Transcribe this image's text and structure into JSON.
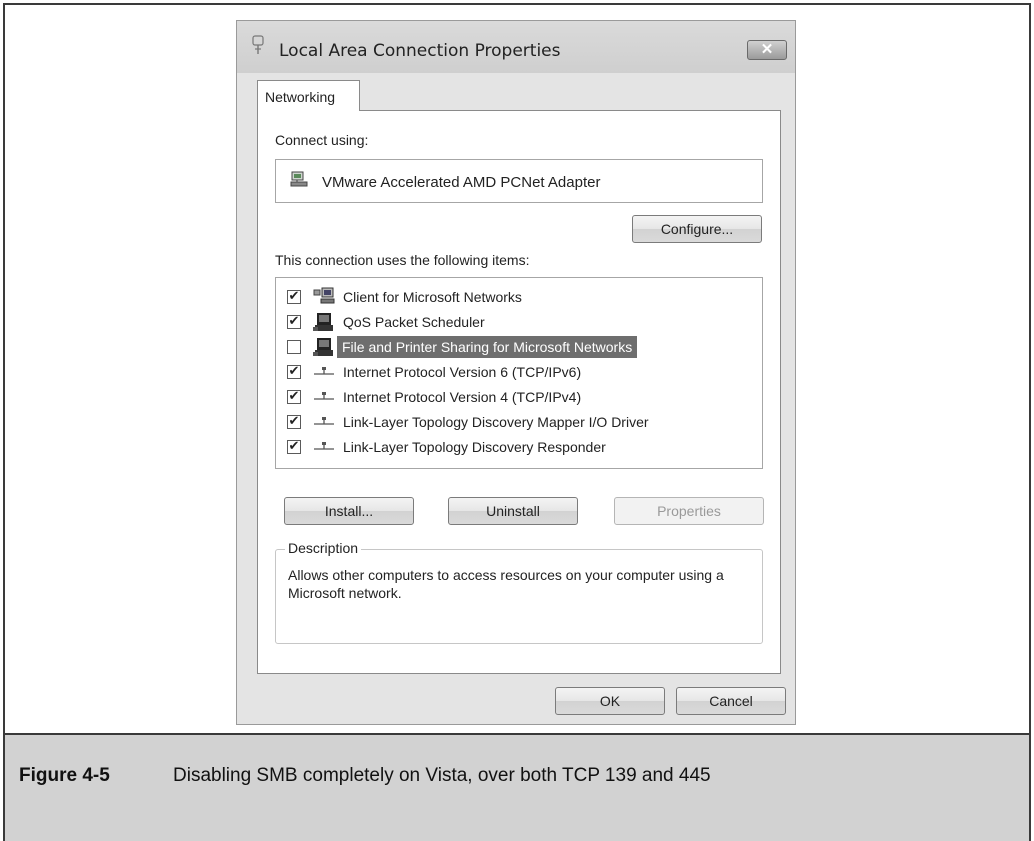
{
  "dialog": {
    "title": "Local Area Connection Properties",
    "close_label": "✕",
    "tab": "Networking",
    "connect_using_label": "Connect using:",
    "adapter_name": "VMware Accelerated AMD PCNet Adapter",
    "configure_label": "Configure...",
    "items_label": "This connection uses the following items:",
    "items": [
      {
        "label": "Client for Microsoft Networks",
        "checked": true,
        "selected": false,
        "icon": "network-client-icon"
      },
      {
        "label": "QoS Packet Scheduler",
        "checked": true,
        "selected": false,
        "icon": "service-icon"
      },
      {
        "label": "File and Printer Sharing for Microsoft Networks",
        "checked": false,
        "selected": true,
        "icon": "service-icon"
      },
      {
        "label": "Internet Protocol Version 6 (TCP/IPv6)",
        "checked": true,
        "selected": false,
        "icon": "protocol-icon"
      },
      {
        "label": "Internet Protocol Version 4 (TCP/IPv4)",
        "checked": true,
        "selected": false,
        "icon": "protocol-icon"
      },
      {
        "label": "Link-Layer Topology Discovery Mapper I/O Driver",
        "checked": true,
        "selected": false,
        "icon": "protocol-icon"
      },
      {
        "label": "Link-Layer Topology Discovery Responder",
        "checked": true,
        "selected": false,
        "icon": "protocol-icon"
      }
    ],
    "install_label": "Install...",
    "uninstall_label": "Uninstall",
    "properties_label": "Properties",
    "description_legend": "Description",
    "description_text": "Allows other computers to access resources on your computer using a Microsoft network.",
    "ok_label": "OK",
    "cancel_label": "Cancel"
  },
  "caption": {
    "number": "Figure 4-5",
    "text": "Disabling SMB completely on Vista, over both TCP 139 and 445"
  }
}
